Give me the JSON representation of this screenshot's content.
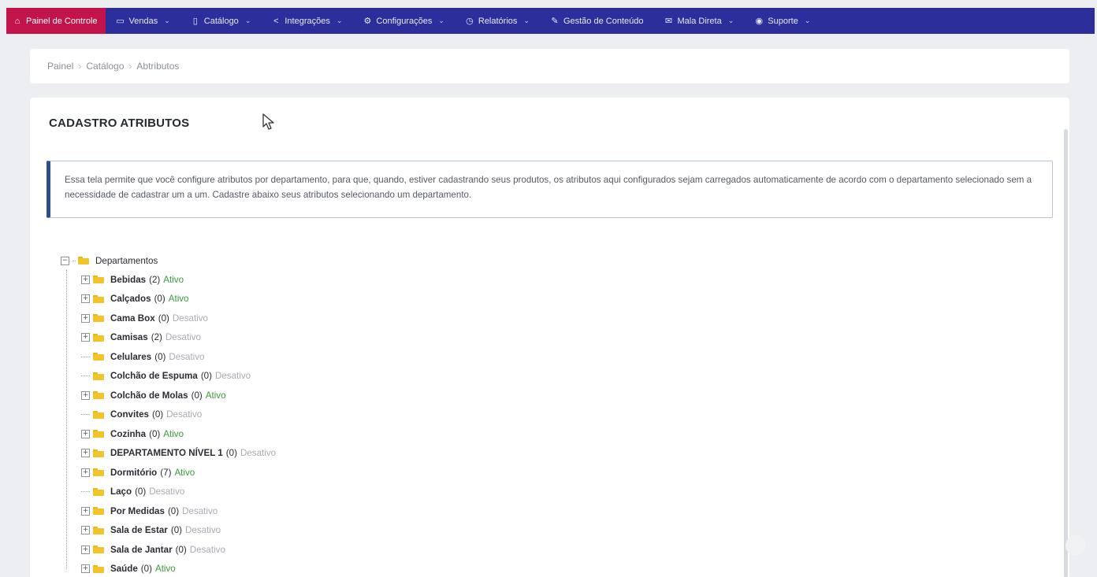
{
  "nav": [
    {
      "label": "Painel de Controle",
      "icon": "home-icon",
      "active": true,
      "dropdown": false
    },
    {
      "label": "Vendas",
      "icon": "cart-icon",
      "active": false,
      "dropdown": true
    },
    {
      "label": "Catálogo",
      "icon": "book-icon",
      "active": false,
      "dropdown": true
    },
    {
      "label": "Integrações",
      "icon": "share-icon",
      "active": false,
      "dropdown": true
    },
    {
      "label": "Configurações",
      "icon": "gear-icon",
      "active": false,
      "dropdown": true
    },
    {
      "label": "Relatórios",
      "icon": "history-icon",
      "active": false,
      "dropdown": true
    },
    {
      "label": "Gestão de Conteúdo",
      "icon": "edit-icon",
      "active": false,
      "dropdown": false
    },
    {
      "label": "Mala Direta",
      "icon": "mail-icon",
      "active": false,
      "dropdown": true
    },
    {
      "label": "Suporte",
      "icon": "support-icon",
      "active": false,
      "dropdown": true
    }
  ],
  "breadcrumb": [
    "Painel",
    "Catálogo",
    "Abtributos"
  ],
  "page": {
    "title": "CADASTRO ATRIBUTOS",
    "info": "Essa tela permite que você configure atributos por departamento, para que, quando, estiver cadastrando seus produtos, os atributos aqui configurados sejam carregados automaticamente de acordo com o departamento selecionado sem a necessidade de cadastrar um a um. Cadastre abaixo seus atributos selecionando um departamento."
  },
  "tree": {
    "root": {
      "label": "Departamentos",
      "expander": "−"
    },
    "items": [
      {
        "name": "Bebidas",
        "count": "(2)",
        "status": "Ativo",
        "expandable": true
      },
      {
        "name": "Calçados",
        "count": "(0)",
        "status": "Ativo",
        "expandable": true
      },
      {
        "name": "Cama Box",
        "count": "(0)",
        "status": "Desativo",
        "expandable": true
      },
      {
        "name": "Camisas",
        "count": "(2)",
        "status": "Desativo",
        "expandable": true
      },
      {
        "name": "Celulares",
        "count": "(0)",
        "status": "Desativo",
        "expandable": false
      },
      {
        "name": "Colchão de Espuma",
        "count": "(0)",
        "status": "Desativo",
        "expandable": false
      },
      {
        "name": "Colchão de Molas",
        "count": "(0)",
        "status": "Ativo",
        "expandable": true
      },
      {
        "name": "Convites",
        "count": "(0)",
        "status": "Desativo",
        "expandable": false
      },
      {
        "name": "Cozinha",
        "count": "(0)",
        "status": "Ativo",
        "expandable": true
      },
      {
        "name": "DEPARTAMENTO NÍVEL 1",
        "count": "(0)",
        "status": "Desativo",
        "expandable": true
      },
      {
        "name": "Dormitório",
        "count": "(7)",
        "status": "Ativo",
        "expandable": true
      },
      {
        "name": "Laço",
        "count": "(0)",
        "status": "Desativo",
        "expandable": false
      },
      {
        "name": "Por Medidas",
        "count": "(0)",
        "status": "Desativo",
        "expandable": true
      },
      {
        "name": "Sala de Estar",
        "count": "(0)",
        "status": "Desativo",
        "expandable": true
      },
      {
        "name": "Sala de Jantar",
        "count": "(0)",
        "status": "Desativo",
        "expandable": true
      },
      {
        "name": "Saúde",
        "count": "(0)",
        "status": "Ativo",
        "expandable": true
      }
    ]
  },
  "colors": {
    "nav_bg": "#2c2f9b",
    "nav_active": "#c2134b",
    "ativo": "#3a9a3a",
    "desativo": "#a7abb2",
    "folder": "#f2c42a"
  }
}
